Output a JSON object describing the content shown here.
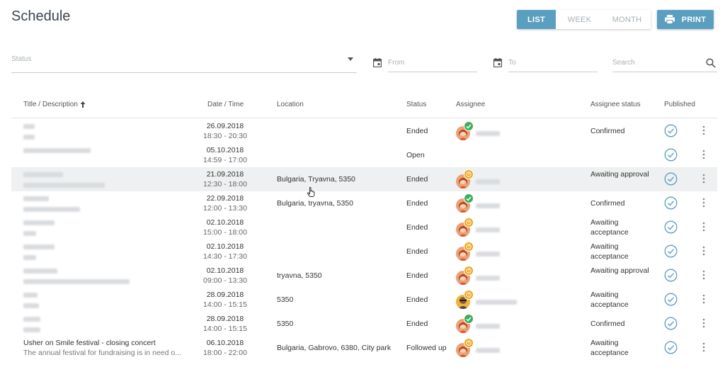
{
  "page": {
    "title": "Schedule"
  },
  "view_toggle": {
    "list": "LIST",
    "week": "WEEK",
    "month": "MONTH",
    "active": "list"
  },
  "print": {
    "label": "PRINT",
    "icon": "printer-icon"
  },
  "filters": {
    "status_placeholder": "Status",
    "from_placeholder": "From",
    "to_placeholder": "To",
    "search_placeholder": "Search"
  },
  "columns": {
    "title": "Title / Description",
    "datetime": "Date / Time",
    "location": "Location",
    "status": "Status",
    "assignee": "Assignee",
    "assignee_status": "Assignee status",
    "published": "Published"
  },
  "colors": {
    "accent": "#5a9fc0",
    "confirmed_badge": "#3fae5a",
    "waiting_badge": "#f2a51a",
    "published_check": "#5a9fc0"
  },
  "rows": [
    {
      "title": "",
      "description": "",
      "date": "26.09.2018",
      "time": "18:30 - 20:30",
      "location": "",
      "status": "Ended",
      "has_assignee": true,
      "badge": "ok",
      "assignee_status": "Confirmed",
      "published": true
    },
    {
      "title": "",
      "description": "",
      "date": "05.10.2018",
      "time": "14:59 - 17:00",
      "location": "",
      "status": "Open",
      "has_assignee": false,
      "badge": "",
      "assignee_status": "",
      "published": true
    },
    {
      "title": "",
      "description": "",
      "date": "21.09.2018",
      "time": "12:30 - 18:00",
      "location": "Bulgaria, Tryavna, 5350",
      "status": "Ended",
      "has_assignee": true,
      "badge": "wait",
      "assignee_status": "Awaiting approval",
      "published": true
    },
    {
      "title": "",
      "description": "",
      "date": "22.09.2018",
      "time": "12:00 - 13:30",
      "location": "Bulgaria, tryavna, 5350",
      "status": "Ended",
      "has_assignee": true,
      "badge": "ok",
      "assignee_status": "Confirmed",
      "published": true
    },
    {
      "title": "",
      "description": "",
      "date": "02.10.2018",
      "time": "15:00 - 18:00",
      "location": "",
      "status": "Ended",
      "has_assignee": true,
      "badge": "wait",
      "assignee_status": "Awaiting acceptance",
      "published": true
    },
    {
      "title": "",
      "description": "",
      "date": "02.10.2018",
      "time": "14:30 - 17:30",
      "location": "",
      "status": "Ended",
      "has_assignee": true,
      "badge": "wait",
      "assignee_status": "Awaiting acceptance",
      "published": true
    },
    {
      "title": "",
      "description": "",
      "date": "02.10.2018",
      "time": "09:00 - 13:30",
      "location": "tryavna, 5350",
      "status": "Ended",
      "has_assignee": true,
      "badge": "wait",
      "assignee_status": "Awaiting approval",
      "published": true
    },
    {
      "title": "",
      "description": "",
      "date": "28.09.2018",
      "time": "14:00 - 15:15",
      "location": "5350",
      "status": "Ended",
      "has_assignee": true,
      "badge": "wait",
      "assignee_status": "Awaiting acceptance",
      "published": true
    },
    {
      "title": "",
      "description": "",
      "date": "28.09.2018",
      "time": "14:00 - 15:15",
      "location": "5350",
      "status": "Ended",
      "has_assignee": true,
      "badge": "ok",
      "assignee_status": "Confirmed",
      "published": true
    },
    {
      "title": "Usher on Smile festival - closing concert",
      "description": "The annual festival for fundraising is in need o...",
      "date": "06.10.2018",
      "time": "18:00 - 22:00",
      "location": "Bulgaria, Gabrovo, 6380, City park",
      "status": "Followed up",
      "has_assignee": true,
      "badge": "wait",
      "assignee_status": "Awaiting acceptance",
      "published": true
    }
  ]
}
